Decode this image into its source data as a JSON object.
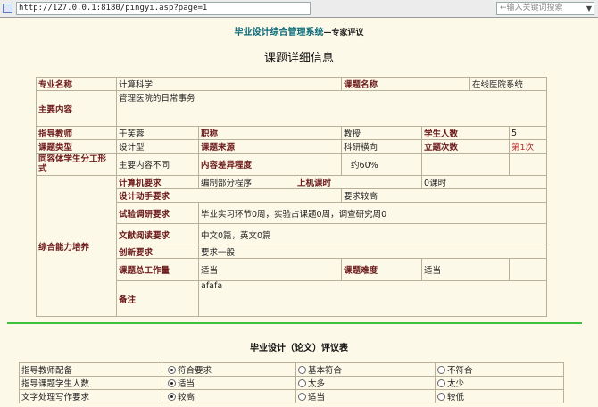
{
  "browser": {
    "url": "http://127.0.0.1:8180/pingyi.asp?page=1",
    "search_placeholder": "←输入关键词搜索"
  },
  "header": {
    "system": "毕业设计综合管理系统",
    "separator_sub": "—专家评议"
  },
  "page_heading": "课题详细信息",
  "info": {
    "major_label": "专业名称",
    "major_value": "计算科学",
    "topic_label": "课题名称",
    "topic_value": "在线医院系统",
    "content_label": "主要内容",
    "content_value": "管理医院的日常事务",
    "advisor_label": "指导教师",
    "advisor_value": "于芙蓉",
    "title_label": "职称",
    "title_value": "教授",
    "students_label": "学生人数",
    "students_value": "5",
    "type_label": "课题类型",
    "type_value": "设计型",
    "source_label": "课题来源",
    "source_value": "科研横向",
    "times_label": "立题次数",
    "times_value": "第1次",
    "split_label": "同容体学生分工形式",
    "split_value": "主要内容不同",
    "diff_label": "内容差异程度",
    "diff_value": "约60%",
    "ability_label": "综合能力培养",
    "computer_label": "计算机要求",
    "computer_value": "编制部分程序",
    "machine_label": "上机课时",
    "machine_value": "0课时",
    "design_label": "设计动手要求",
    "design_value": "要求较高",
    "experiment_label": "试验调研要求",
    "experiment_value": "毕业实习环节0周，实验占课题0周，调查研究周0",
    "literature_label": "文献阅读要求",
    "literature_value": "中文0篇，英文0篇",
    "innovation_label": "创新要求",
    "innovation_value": "要求一般",
    "workload_label": "课题总工作量",
    "workload_value": "适当",
    "difficulty_label": "课题难度",
    "difficulty_value": "适当",
    "remark_label": "备注",
    "remark_value": "afafa"
  },
  "eval": {
    "title": "毕业设计（论文）评议表",
    "rows": [
      {
        "label": "指导教师配备",
        "o1": "符合要求",
        "o2": "基本符合",
        "o3": "不符合"
      },
      {
        "label": "指导课题学生人数",
        "o1": "适当",
        "o2": "太多",
        "o3": "太少"
      },
      {
        "label": "文字处理写作要求",
        "o1": "较高",
        "o2": "适当",
        "o3": "较低"
      }
    ]
  }
}
